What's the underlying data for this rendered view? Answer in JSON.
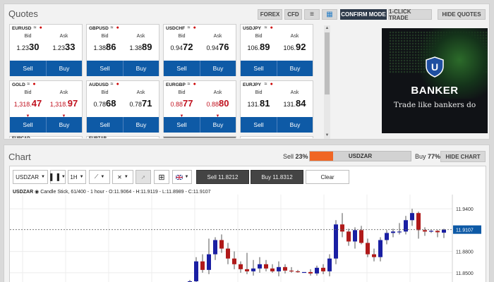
{
  "quotes": {
    "title": "Quotes",
    "toolbar": {
      "forex": "FOREX",
      "cfd": "CFD",
      "list_view": "≡",
      "grid_view": "▦",
      "confirm_mode": "CONFIRM MODE",
      "one_click": "1-CLICK TRADE",
      "hide_quotes": "HIDE QUOTES"
    },
    "tiles": [
      {
        "symbol": "EURUSD",
        "bid_label": "Bid",
        "ask_label": "Ask",
        "bid_prefix": "1.23",
        "bid_main": "30",
        "ask_prefix": "1.23",
        "ask_main": "33",
        "sell": "Sell",
        "buy": "Buy",
        "direction": "neutral"
      },
      {
        "symbol": "GBPUSD",
        "bid_label": "Bid",
        "ask_label": "Ask",
        "bid_prefix": "1.38",
        "bid_main": "86",
        "ask_prefix": "1.38",
        "ask_main": "89",
        "sell": "Sell",
        "buy": "Buy",
        "direction": "neutral"
      },
      {
        "symbol": "USDCHF",
        "bid_label": "Bid",
        "ask_label": "Ask",
        "bid_prefix": "0.94",
        "bid_main": "72",
        "ask_prefix": "0.94",
        "ask_main": "76",
        "sell": "Sell",
        "buy": "Buy",
        "direction": "neutral"
      },
      {
        "symbol": "USDJPY",
        "bid_label": "Bid",
        "ask_label": "Ask",
        "bid_prefix": "106.",
        "bid_main": "89",
        "ask_prefix": "106.",
        "ask_main": "92",
        "sell": "Sell",
        "buy": "Buy",
        "direction": "neutral"
      },
      {
        "symbol": "GOLD",
        "bid_label": "Bid",
        "ask_label": "Ask",
        "bid_prefix": "1,318.",
        "bid_main": "47",
        "ask_prefix": "1,318.",
        "ask_main": "97",
        "sell": "Sell",
        "buy": "Buy",
        "direction": "down"
      },
      {
        "symbol": "AUDUSD",
        "bid_label": "Bid",
        "ask_label": "Ask",
        "bid_prefix": "0.78",
        "bid_main": "68",
        "ask_prefix": "0.78",
        "ask_main": "71",
        "sell": "Sell",
        "buy": "Buy",
        "direction": "neutral"
      },
      {
        "symbol": "EURGBP",
        "bid_label": "Bid",
        "ask_label": "Ask",
        "bid_prefix": "0.88",
        "bid_main": "77",
        "ask_prefix": "0.88",
        "ask_main": "80",
        "sell": "Sell",
        "buy": "Buy",
        "direction": "down"
      },
      {
        "symbol": "EURJPY",
        "bid_label": "Bid",
        "ask_label": "Ask",
        "bid_prefix": "131.",
        "bid_main": "81",
        "ask_prefix": "131.",
        "ask_main": "84",
        "sell": "Sell",
        "buy": "Buy",
        "direction": "neutral"
      }
    ],
    "partial_tiles": [
      "EURCAD",
      "EURZAR",
      "",
      ""
    ]
  },
  "ad": {
    "shield_letter": "U",
    "brand": "BANKER",
    "tagline": "Trade like bankers do"
  },
  "chart": {
    "title": "Chart",
    "sell_label": "Sell",
    "sell_pct": "23%",
    "sell_fraction": 0.23,
    "buy_label": "Buy",
    "buy_pct": "77%",
    "sentiment_symbol": "USDZAR",
    "hide_chart": "HIDE CHART",
    "toolbar": {
      "symbol": "USDZAR",
      "timeframe": "1H",
      "sell_button": "Sell 11.8212",
      "buy_button": "Buy 11.8312",
      "clear": "Clear"
    },
    "info_symbol": "USDZAR",
    "info_text": "Candle Stick, 61/400 - 1 hour - O:11.9064 - H:11.9119 - L:11.8989 - C:11.9107",
    "price_axis": [
      "11.9400",
      "11.8800",
      "11.8500"
    ],
    "current_price": "11.9107"
  },
  "colors": {
    "primary_blue": "#0e5aa6",
    "down_red": "#c0111e",
    "sell_orange": "#f06624",
    "candle_up": "#1a1fa3",
    "candle_down": "#b01a1a"
  },
  "chart_data": {
    "type": "candlestick",
    "ylim": [
      11.835,
      11.96
    ],
    "price_labels": [
      11.94,
      11.88,
      11.85
    ],
    "current": 11.9107,
    "candles": [
      {
        "o": 11.835,
        "h": 11.84,
        "l": 11.832,
        "c": 11.838
      },
      {
        "o": 11.838,
        "h": 11.872,
        "l": 11.834,
        "c": 11.866
      },
      {
        "o": 11.866,
        "h": 11.876,
        "l": 11.85,
        "c": 11.854
      },
      {
        "o": 11.854,
        "h": 11.898,
        "l": 11.848,
        "c": 11.876
      },
      {
        "o": 11.876,
        "h": 11.9,
        "l": 11.868,
        "c": 11.896
      },
      {
        "o": 11.896,
        "h": 11.904,
        "l": 11.878,
        "c": 11.884
      },
      {
        "o": 11.884,
        "h": 11.892,
        "l": 11.862,
        "c": 11.87
      },
      {
        "o": 11.87,
        "h": 11.88,
        "l": 11.855,
        "c": 11.862
      },
      {
        "o": 11.862,
        "h": 11.866,
        "l": 11.85,
        "c": 11.855
      },
      {
        "o": 11.855,
        "h": 11.878,
        "l": 11.848,
        "c": 11.852
      },
      {
        "o": 11.852,
        "h": 11.868,
        "l": 11.846,
        "c": 11.856
      },
      {
        "o": 11.856,
        "h": 11.872,
        "l": 11.85,
        "c": 11.862
      },
      {
        "o": 11.862,
        "h": 11.868,
        "l": 11.852,
        "c": 11.856
      },
      {
        "o": 11.856,
        "h": 11.862,
        "l": 11.85,
        "c": 11.852
      },
      {
        "o": 11.852,
        "h": 11.866,
        "l": 11.845,
        "c": 11.858
      },
      {
        "o": 11.858,
        "h": 11.862,
        "l": 11.849,
        "c": 11.853
      },
      {
        "o": 11.853,
        "h": 11.858,
        "l": 11.85,
        "c": 11.852
      },
      {
        "o": 11.852,
        "h": 11.854,
        "l": 11.85,
        "c": 11.851
      },
      {
        "o": 11.851,
        "h": 11.851,
        "l": 11.851,
        "c": 11.851
      },
      {
        "o": 11.851,
        "h": 11.855,
        "l": 11.846,
        "c": 11.849
      },
      {
        "o": 11.849,
        "h": 11.86,
        "l": 11.846,
        "c": 11.857
      },
      {
        "o": 11.857,
        "h": 11.862,
        "l": 11.848,
        "c": 11.852
      },
      {
        "o": 11.852,
        "h": 11.876,
        "l": 11.845,
        "c": 11.87
      },
      {
        "o": 11.87,
        "h": 11.924,
        "l": 11.862,
        "c": 11.918
      },
      {
        "o": 11.918,
        "h": 11.934,
        "l": 11.9,
        "c": 11.908
      },
      {
        "o": 11.908,
        "h": 11.912,
        "l": 11.888,
        "c": 11.894
      },
      {
        "o": 11.894,
        "h": 11.914,
        "l": 11.884,
        "c": 11.91
      },
      {
        "o": 11.91,
        "h": 11.916,
        "l": 11.89,
        "c": 11.892
      },
      {
        "o": 11.892,
        "h": 11.898,
        "l": 11.872,
        "c": 11.876
      },
      {
        "o": 11.876,
        "h": 11.884,
        "l": 11.866,
        "c": 11.872
      },
      {
        "o": 11.872,
        "h": 11.9,
        "l": 11.866,
        "c": 11.896
      },
      {
        "o": 11.896,
        "h": 11.91,
        "l": 11.89,
        "c": 11.906
      },
      {
        "o": 11.906,
        "h": 11.912,
        "l": 11.9,
        "c": 11.908
      },
      {
        "o": 11.908,
        "h": 11.92,
        "l": 11.904,
        "c": 11.908
      },
      {
        "o": 11.908,
        "h": 11.93,
        "l": 11.904,
        "c": 11.924
      },
      {
        "o": 11.924,
        "h": 11.94,
        "l": 11.916,
        "c": 11.934
      },
      {
        "o": 11.934,
        "h": 11.936,
        "l": 11.898,
        "c": 11.91
      },
      {
        "o": 11.91,
        "h": 11.914,
        "l": 11.902,
        "c": 11.908
      },
      {
        "o": 11.908,
        "h": 11.91,
        "l": 11.906,
        "c": 11.909
      },
      {
        "o": 11.909,
        "h": 11.91,
        "l": 11.9,
        "c": 11.907
      },
      {
        "o": 11.9064,
        "h": 11.9119,
        "l": 11.8989,
        "c": 11.9107
      }
    ]
  }
}
